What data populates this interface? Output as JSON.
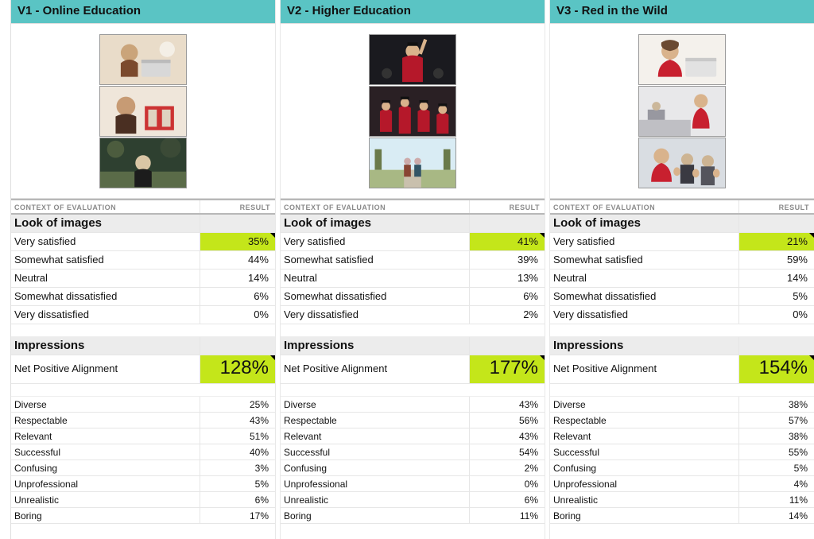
{
  "column_hdr_context": "CONTEXT OF EVALUATION",
  "column_hdr_result": "RESULT",
  "section_look": "Look of images",
  "section_impressions": "Impressions",
  "net_label": "Net Positive Alignment",
  "look_rows": [
    "Very satisfied",
    "Somewhat satisfied",
    "Neutral",
    "Somewhat dissatisfied",
    "Very dissatisfied"
  ],
  "imp_rows": [
    "Diverse",
    "Respectable",
    "Relevant",
    "Successful",
    "Confusing",
    "Unprofessional",
    "Unrealistic",
    "Boring"
  ],
  "panels": [
    {
      "title": "V1 - Online Education",
      "look_vals": [
        "35%",
        "44%",
        "14%",
        "6%",
        "0%"
      ],
      "net_val": "128%",
      "imp_vals": [
        "25%",
        "43%",
        "51%",
        "40%",
        "3%",
        "5%",
        "6%",
        "17%"
      ]
    },
    {
      "title": "V2 - Higher Education",
      "look_vals": [
        "41%",
        "39%",
        "13%",
        "6%",
        "2%"
      ],
      "net_val": "177%",
      "imp_vals": [
        "43%",
        "56%",
        "43%",
        "54%",
        "2%",
        "0%",
        "6%",
        "11%"
      ]
    },
    {
      "title": "V3 - Red in the Wild",
      "look_vals": [
        "21%",
        "59%",
        "14%",
        "5%",
        "0%"
      ],
      "net_val": "154%",
      "imp_vals": [
        "38%",
        "57%",
        "38%",
        "55%",
        "5%",
        "4%",
        "11%",
        "14%"
      ]
    }
  ]
}
